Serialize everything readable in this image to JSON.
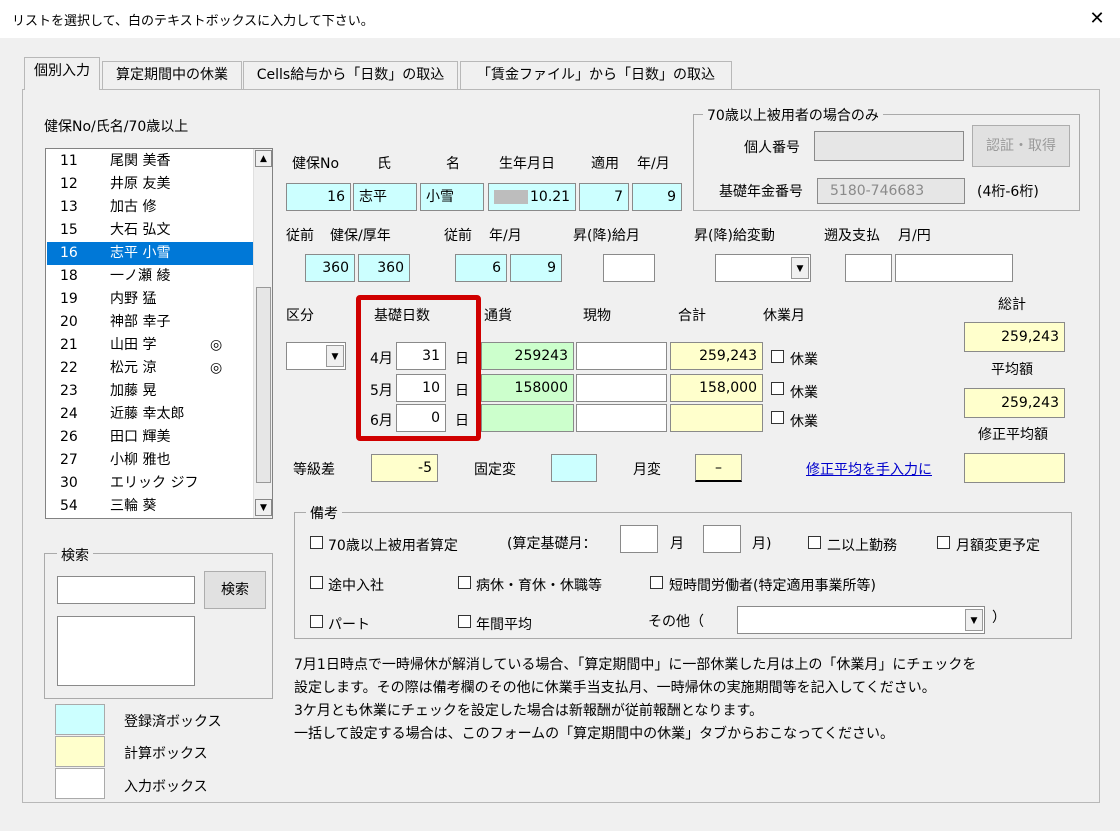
{
  "window": {
    "title": "リストを選択して、白のテキストボックスに入力して下さい。",
    "close": "✕"
  },
  "tabs": [
    "個別入力",
    "算定期間中の休業",
    "Cells給与から「日数」の取込",
    "「賃金ファイル」から「日数」の取込"
  ],
  "list": {
    "label": "健保No/氏名/70歳以上",
    "rows": [
      {
        "no": "11",
        "name": "尾関 美香",
        "mark": ""
      },
      {
        "no": "12",
        "name": "井原 友美",
        "mark": ""
      },
      {
        "no": "13",
        "name": "加古 修",
        "mark": ""
      },
      {
        "no": "15",
        "name": "大石 弘文",
        "mark": ""
      },
      {
        "no": "16",
        "name": "志平 小雪",
        "mark": ""
      },
      {
        "no": "18",
        "name": "一ノ瀬 綾",
        "mark": ""
      },
      {
        "no": "19",
        "name": "内野 猛",
        "mark": ""
      },
      {
        "no": "20",
        "name": "神部 幸子",
        "mark": ""
      },
      {
        "no": "21",
        "name": "山田 学",
        "mark": "◎"
      },
      {
        "no": "22",
        "name": "松元 涼",
        "mark": "◎"
      },
      {
        "no": "23",
        "name": "加藤 晃",
        "mark": ""
      },
      {
        "no": "24",
        "name": "近藤 幸太郎",
        "mark": ""
      },
      {
        "no": "26",
        "name": "田口 輝美",
        "mark": ""
      },
      {
        "no": "27",
        "name": "小柳 雅也",
        "mark": ""
      },
      {
        "no": "30",
        "name": "エリック ジフ",
        "mark": ""
      },
      {
        "no": "54",
        "name": "三輪 葵",
        "mark": ""
      }
    ],
    "selected_index": 4
  },
  "search": {
    "group_label": "検索",
    "button": "検索",
    "value": ""
  },
  "legend": {
    "registered": "登録済ボックス",
    "calc": "計算ボックス",
    "input": "入力ボックス"
  },
  "over70": {
    "group_label": "70歳以上被用者の場合のみ",
    "personal_no_label": "個人番号",
    "personal_no": "",
    "auth_button": "認証・取得",
    "pension_label": "基礎年金番号",
    "pension_no": "5180-746683",
    "pension_hint": "(4桁-6桁)"
  },
  "employee": {
    "headers": {
      "no": "健保No",
      "last": "氏",
      "first": "名",
      "birth": "生年月日",
      "apply": "適用",
      "ym": "年/月"
    },
    "no": "16",
    "last": "志平",
    "first": "小雪",
    "birth": "10.21",
    "apply_y": "7",
    "apply_m": "9"
  },
  "previous": {
    "label_prev": "従前",
    "label_kenpo": "健保/厚年",
    "label_prev2": "従前",
    "label_ym": "年/月",
    "label_raise_month": "昇(降)給月",
    "label_raise_change": "昇(降)給変動",
    "label_retro": "遡及支払",
    "label_retro_ym": "月/円",
    "kenpo": "360",
    "kosei": "360",
    "year": "6",
    "month": "9"
  },
  "pay": {
    "headers": {
      "kubun": "区分",
      "days": "基礎日数",
      "cash": "通貨",
      "goods": "現物",
      "total": "合計",
      "leave": "休業月"
    },
    "rows": [
      {
        "month": "4月",
        "days": "31",
        "unit": "日",
        "cash": "259243",
        "goods": "",
        "total": "259,243",
        "leave": "休業"
      },
      {
        "month": "5月",
        "days": "10",
        "unit": "日",
        "cash": "158000",
        "goods": "",
        "total": "158,000",
        "leave": "休業"
      },
      {
        "month": "6月",
        "days": "0",
        "unit": "日",
        "cash": "",
        "goods": "",
        "total": "",
        "leave": "休業"
      }
    ],
    "sum_label": "総計",
    "sum": "259,243",
    "avg_label": "平均額",
    "avg": "259,243",
    "mod_avg_label": "修正平均額",
    "mod_avg": ""
  },
  "grade": {
    "diff_label": "等級差",
    "diff": "-5",
    "fixed_label": "固定変",
    "fixed": "",
    "month_label": "月変",
    "month_value": "–",
    "manual_link": "修正平均を手入力に"
  },
  "remarks": {
    "group_label": "備考",
    "over70": "70歳以上被用者算定",
    "base_month_label": "(算定基礎月：",
    "month_unit": "月",
    "month_unit_close": "月)",
    "multiple": "二以上勤務",
    "monthly_change": "月額変更予定",
    "midjoin": "途中入社",
    "sick": "病休・育休・休職等",
    "short_time": "短時間労働者(特定適用事業所等)",
    "part": "パート",
    "annual_avg": "年間平均",
    "other_label": "その他（",
    "other_close": "）"
  },
  "notes": [
    "7月1日時点で一時帰休が解消している場合、「算定期間中」に一部休業した月は上の「休業月」にチェックを",
    "設定します。その際は備考欄のその他に休業手当支払月、一時帰休の実施期間等を記入してください。",
    "3ケ月とも休業にチェックを設定した場合は新報酬が従前報酬となります。",
    "一括して設定する場合は、このフォームの「算定期間中の休業」タブからおこなってください。"
  ],
  "colors": {
    "registered": "#ccffff",
    "calc": "#ffffcc",
    "green": "#ccffcc",
    "selected": "#0078d7",
    "highlight": "#d00000"
  }
}
